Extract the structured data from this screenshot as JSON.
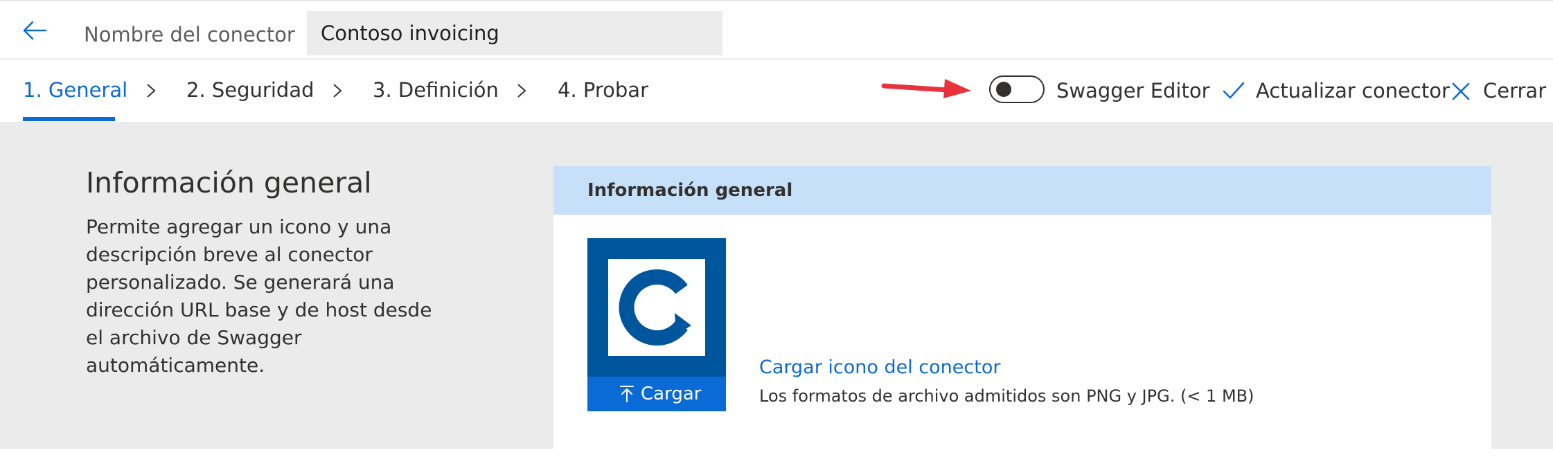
{
  "header": {
    "connector_name_label": "Nombre del conector",
    "connector_name_value": "Contoso invoicing"
  },
  "tabs": [
    {
      "label": "1. General",
      "active": true
    },
    {
      "label": "2. Seguridad",
      "active": false
    },
    {
      "label": "3. Definición",
      "active": false
    },
    {
      "label": "4. Probar",
      "active": false
    }
  ],
  "toolbar": {
    "swagger_editor_label": "Swagger Editor",
    "swagger_editor_on": false,
    "update_label": "Actualizar conector",
    "close_label": "Cerrar"
  },
  "sidebar": {
    "title": "Información general",
    "description": "Permite agregar un icono y una descripción breve al conector personalizado. Se generará una dirección URL base y de host desde el archivo de Swagger automáticamente."
  },
  "card": {
    "header_title": "Información general",
    "upload_button_label": "Cargar",
    "upload_link_label": "Cargar icono del conector",
    "formats_text": "Los formatos de archivo admitidos son PNG y JPG. (< 1 MB)"
  },
  "icons": {
    "back": "arrow-left-icon",
    "chevron": "chevron-right-icon",
    "annotation": "red-arrow-right-icon",
    "update": "checkmark-icon",
    "close": "close-icon",
    "upload": "upload-arrow-icon",
    "connector_logo": "contoso-c-logo"
  },
  "colors": {
    "accent": "#0b6bd6",
    "card_header_bg": "#c7e0f9",
    "logo_bg": "#00569d",
    "page_bg": "#ebebeb",
    "annotation_red": "#e8333c"
  }
}
